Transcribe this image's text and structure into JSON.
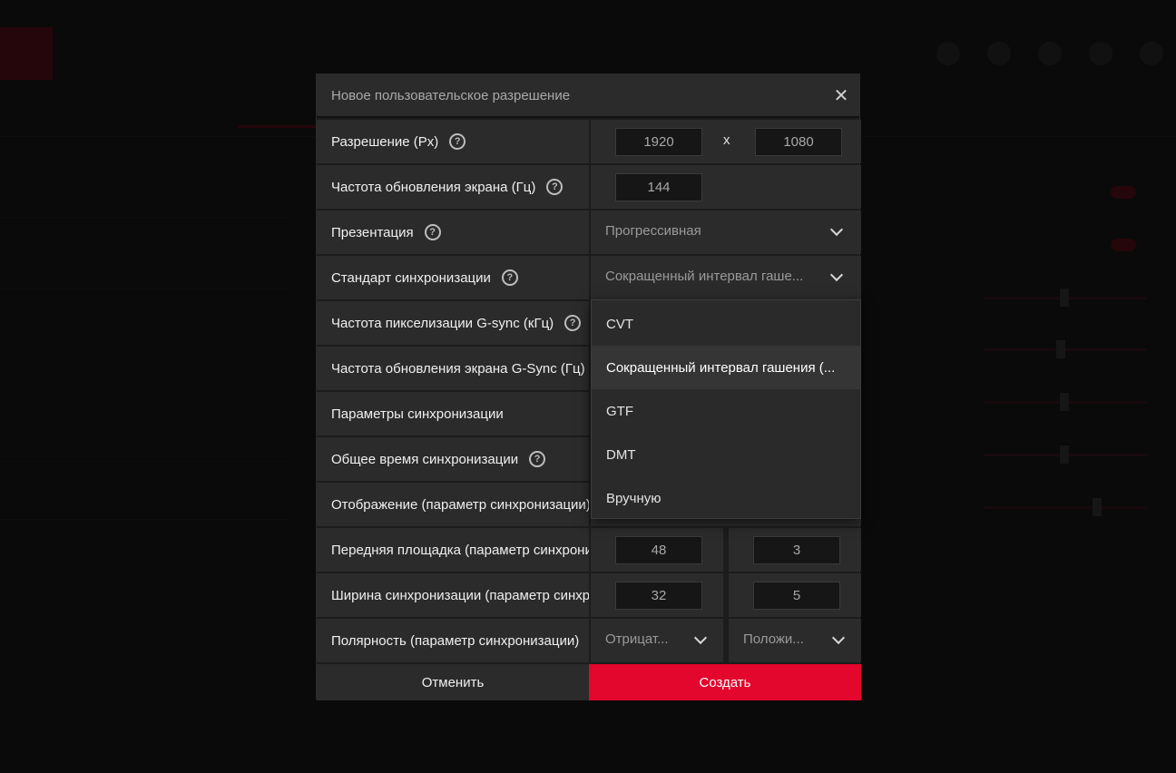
{
  "dialog": {
    "title": "Новое пользовательское разрешение",
    "close_glyph": "✕",
    "help_glyph": "?"
  },
  "rows": {
    "resolution": {
      "label": "Разрешение (Px)",
      "width": "1920",
      "height": "1080",
      "separator": "x"
    },
    "refresh_rate": {
      "label": "Частота обновления экрана (Гц)",
      "value": "144"
    },
    "presentation": {
      "label": "Презентация",
      "selected": "Прогрессивная"
    },
    "timing_standard": {
      "label": "Стандарт синхронизации",
      "selected": "Сокращенный интервал гаше..."
    },
    "pixel_clock": {
      "label": "Частота пикселизации G-sync (кГц)"
    },
    "gsync_refresh": {
      "label": "Частота обновления экрана G-Sync (Гц)"
    },
    "timing_params": {
      "label": "Параметры синхронизации"
    },
    "total_timing": {
      "label": "Общее время синхронизации"
    },
    "display_timing": {
      "label": "Отображение (параметр синхронизации)"
    },
    "front_porch": {
      "label": "Передняя площадка (параметр синхронизации)",
      "horizontal": "48",
      "vertical": "3"
    },
    "sync_width": {
      "label": "Ширина синхронизации (параметр синхронизации)",
      "horizontal": "32",
      "vertical": "5"
    },
    "polarity": {
      "label": "Полярность (параметр синхронизации)",
      "horizontal": "Отрицат...",
      "vertical": "Положи..."
    }
  },
  "dropdown": {
    "options": [
      "CVT",
      "Сокращенный интервал гашения (...",
      "GTF",
      "DMT",
      "Вручную"
    ],
    "highlighted_index": 1
  },
  "buttons": {
    "cancel": "Отменить",
    "create": "Создать"
  },
  "colors": {
    "accent": "#e3062d",
    "panel": "#2b2b2b",
    "input_bg": "#161616"
  }
}
